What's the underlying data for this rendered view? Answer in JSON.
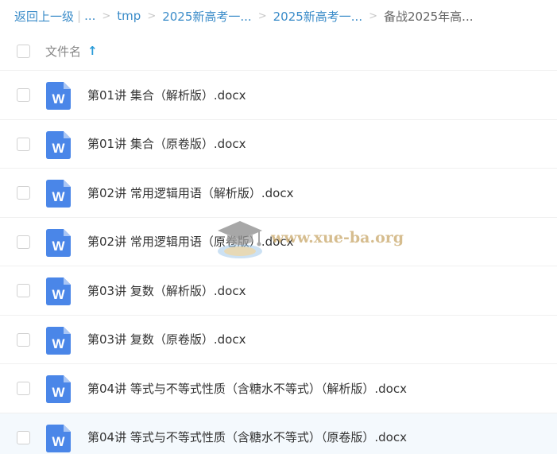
{
  "breadcrumb": {
    "back": "返回上一级",
    "pipe": "|",
    "ellipsis": "...",
    "sep": ">",
    "items": [
      "tmp",
      "2025新高考一...",
      "2025新高考一..."
    ],
    "current": "备战2025年高..."
  },
  "header": {
    "column_label": "文件名",
    "sort_icon": "↑"
  },
  "files": [
    {
      "name": "第01讲 集合（解析版）.docx"
    },
    {
      "name": "第01讲 集合（原卷版）.docx"
    },
    {
      "name": "第02讲 常用逻辑用语（解析版）.docx"
    },
    {
      "name": "第02讲 常用逻辑用语（原卷版）.docx"
    },
    {
      "name": "第03讲 复数（解析版）.docx"
    },
    {
      "name": "第03讲 复数（原卷版）.docx"
    },
    {
      "name": "第04讲 等式与不等式性质（含糖水不等式）（解析版）.docx"
    },
    {
      "name": "第04讲 等式与不等式性质（含糖水不等式）（原卷版）.docx"
    }
  ],
  "icon": {
    "letter": "W",
    "color": "#4a86e8"
  },
  "watermark": {
    "text": "www.xue-ba.org"
  }
}
